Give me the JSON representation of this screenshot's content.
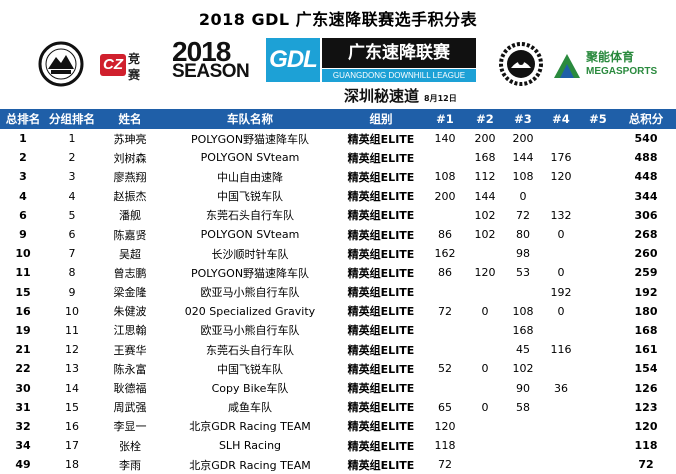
{
  "page": {
    "title": "2018 GDL 广东速降联赛选手积分表"
  },
  "logos": {
    "cz": {
      "mark": "CZ",
      "text_top": "竞",
      "text_bottom": "赛"
    },
    "banner": {
      "year": "2018",
      "season": "SEASON",
      "mark": "GDL",
      "cn_name": "广东速降联赛",
      "en_name": "GUANGDONG DOWNHILL LEAGUE",
      "sub": "深圳秘速道",
      "date": "8月12日"
    },
    "sponsor": {
      "cn": "聚能体育",
      "en": "MEGASPORTS"
    }
  },
  "table": {
    "headers": {
      "overall_rank": "总排名",
      "group_rank": "分组排名",
      "name": "姓名",
      "team": "车队名称",
      "group": "组别",
      "r1": "#1",
      "r2": "#2",
      "r3": "#3",
      "r4": "#4",
      "r5": "#5",
      "total": "总积分"
    },
    "rows": [
      {
        "overall": "1",
        "grp": "1",
        "name": "苏珅亮",
        "team": "POLYGON野猫速降车队",
        "group": "精英组ELITE",
        "r1": "140",
        "r2": "200",
        "r3": "200",
        "r4": "",
        "r5": "",
        "total": "540"
      },
      {
        "overall": "2",
        "grp": "2",
        "name": "刘树森",
        "team": "POLYGON SVteam",
        "group": "精英组ELITE",
        "r1": "",
        "r2": "168",
        "r3": "144",
        "r4": "176",
        "r5": "",
        "total": "488"
      },
      {
        "overall": "3",
        "grp": "3",
        "name": "廖燕翔",
        "team": "中山自由速降",
        "group": "精英组ELITE",
        "r1": "108",
        "r2": "112",
        "r3": "108",
        "r4": "120",
        "r5": "",
        "total": "448"
      },
      {
        "overall": "4",
        "grp": "4",
        "name": "赵振杰",
        "team": "中国飞锐车队",
        "group": "精英组ELITE",
        "r1": "200",
        "r2": "144",
        "r3": "0",
        "r4": "",
        "r5": "",
        "total": "344"
      },
      {
        "overall": "6",
        "grp": "5",
        "name": "潘舰",
        "team": "东莞石头自行车队",
        "group": "精英组ELITE",
        "r1": "",
        "r2": "102",
        "r3": "72",
        "r4": "132",
        "r5": "",
        "total": "306"
      },
      {
        "overall": "9",
        "grp": "6",
        "name": "陈嘉贤",
        "team": "POLYGON SVteam",
        "group": "精英组ELITE",
        "r1": "86",
        "r2": "102",
        "r3": "80",
        "r4": "0",
        "r5": "",
        "total": "268"
      },
      {
        "overall": "10",
        "grp": "7",
        "name": "吴超",
        "team": "长沙顺时针车队",
        "group": "精英组ELITE",
        "r1": "162",
        "r2": "",
        "r3": "98",
        "r4": "",
        "r5": "",
        "total": "260"
      },
      {
        "overall": "11",
        "grp": "8",
        "name": "曾志鹏",
        "team": "POLYGON野猫速降车队",
        "group": "精英组ELITE",
        "r1": "86",
        "r2": "120",
        "r3": "53",
        "r4": "0",
        "r5": "",
        "total": "259"
      },
      {
        "overall": "15",
        "grp": "9",
        "name": "梁金隆",
        "team": "欧亚马小熊自行车队",
        "group": "精英组ELITE",
        "r1": "",
        "r2": "",
        "r3": "",
        "r4": "192",
        "r5": "",
        "total": "192"
      },
      {
        "overall": "16",
        "grp": "10",
        "name": "朱健波",
        "team": "020 Specialized Gravity",
        "group": "精英组ELITE",
        "r1": "72",
        "r2": "0",
        "r3": "108",
        "r4": "0",
        "r5": "",
        "total": "180"
      },
      {
        "overall": "19",
        "grp": "11",
        "name": "江思翰",
        "team": "欧亚马小熊自行车队",
        "group": "精英组ELITE",
        "r1": "",
        "r2": "",
        "r3": "168",
        "r4": "",
        "r5": "",
        "total": "168"
      },
      {
        "overall": "21",
        "grp": "12",
        "name": "王赛华",
        "team": "东莞石头自行车队",
        "group": "精英组ELITE",
        "r1": "",
        "r2": "",
        "r3": "45",
        "r4": "116",
        "r5": "",
        "total": "161"
      },
      {
        "overall": "22",
        "grp": "13",
        "name": "陈永富",
        "team": "中国飞锐车队",
        "group": "精英组ELITE",
        "r1": "52",
        "r2": "0",
        "r3": "102",
        "r4": "",
        "r5": "",
        "total": "154"
      },
      {
        "overall": "30",
        "grp": "14",
        "name": "耿德福",
        "team": "Copy Bike车队",
        "group": "精英组ELITE",
        "r1": "",
        "r2": "",
        "r3": "90",
        "r4": "36",
        "r5": "",
        "total": "126"
      },
      {
        "overall": "31",
        "grp": "15",
        "name": "周武强",
        "team": "咸鱼车队",
        "group": "精英组ELITE",
        "r1": "65",
        "r2": "0",
        "r3": "58",
        "r4": "",
        "r5": "",
        "total": "123"
      },
      {
        "overall": "32",
        "grp": "16",
        "name": "李显一",
        "team": "北京GDR Racing TEAM",
        "group": "精英组ELITE",
        "r1": "120",
        "r2": "",
        "r3": "",
        "r4": "",
        "r5": "",
        "total": "120"
      },
      {
        "overall": "34",
        "grp": "17",
        "name": "张栓",
        "team": "SLH Racing",
        "group": "精英组ELITE",
        "r1": "118",
        "r2": "",
        "r3": "",
        "r4": "",
        "r5": "",
        "total": "118"
      },
      {
        "overall": "49",
        "grp": "18",
        "name": "李雨",
        "team": "北京GDR Racing TEAM",
        "group": "精英组ELITE",
        "r1": "72",
        "r2": "",
        "r3": "",
        "r4": "",
        "r5": "",
        "total": "72"
      }
    ]
  }
}
